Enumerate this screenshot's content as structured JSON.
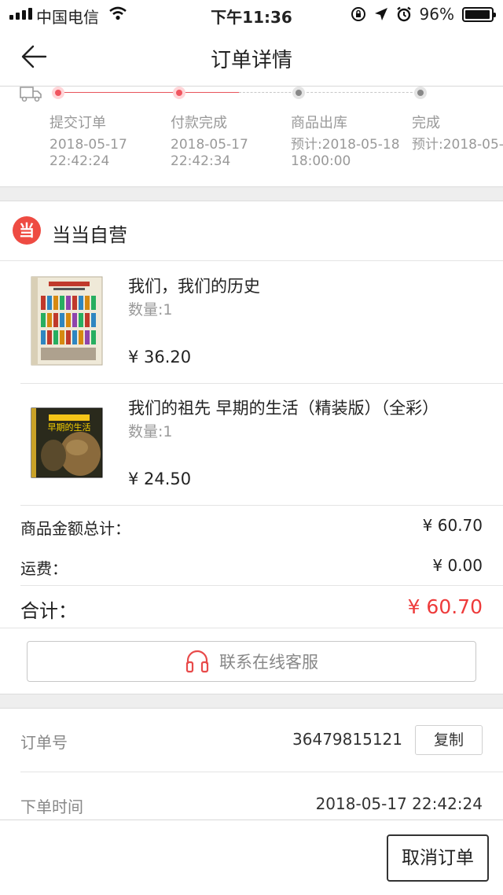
{
  "status_bar": {
    "carrier": "中国电信",
    "time": "下午11:36",
    "battery": "96%",
    "battery_level": 0.96
  },
  "nav": {
    "title": "订单详情"
  },
  "progress": {
    "steps": [
      {
        "label": "提交订单",
        "date_line1": "2018-05-17",
        "date_line2": "22:42:24",
        "state": "done"
      },
      {
        "label": "付款完成",
        "date_line1": "2018-05-17",
        "date_line2": "22:42:34",
        "state": "done"
      },
      {
        "label": "商品出库",
        "date_line1": "预计:2018-05-18",
        "date_line2": "18:00:00",
        "state": "pending"
      },
      {
        "label": "完成",
        "date_line1": "预计:2018-05-",
        "date_line2": "",
        "state": "pending"
      }
    ]
  },
  "store": {
    "logo_text": "当",
    "name": "当当自营"
  },
  "items": [
    {
      "name": "我们，我们的历史",
      "qty": "数量:1",
      "price": "¥ 36.20"
    },
    {
      "name": "我们的祖先 早期的生活（精装版）（全彩）",
      "qty": "数量:1",
      "price": "¥ 24.50",
      "cover_title": "早期的生活"
    }
  ],
  "totals": {
    "subtotal_label": "商品金额总计：",
    "subtotal_value": "¥ 60.70",
    "shipping_label": "运费：",
    "shipping_value": "¥ 0.00",
    "total_label": "合计：",
    "total_value": "¥ 60.70"
  },
  "service_button": "联系在线客服",
  "order_info": {
    "order_no_label": "订单号",
    "order_no": "36479815121",
    "copy_label": "复制",
    "time_label": "下单时间",
    "time_value": "2018-05-17 22:42:24"
  },
  "actions": {
    "cancel_label": "取消订单"
  },
  "colors": {
    "accent_red": "#ee3b3b",
    "brand_red": "#ee4b42"
  }
}
